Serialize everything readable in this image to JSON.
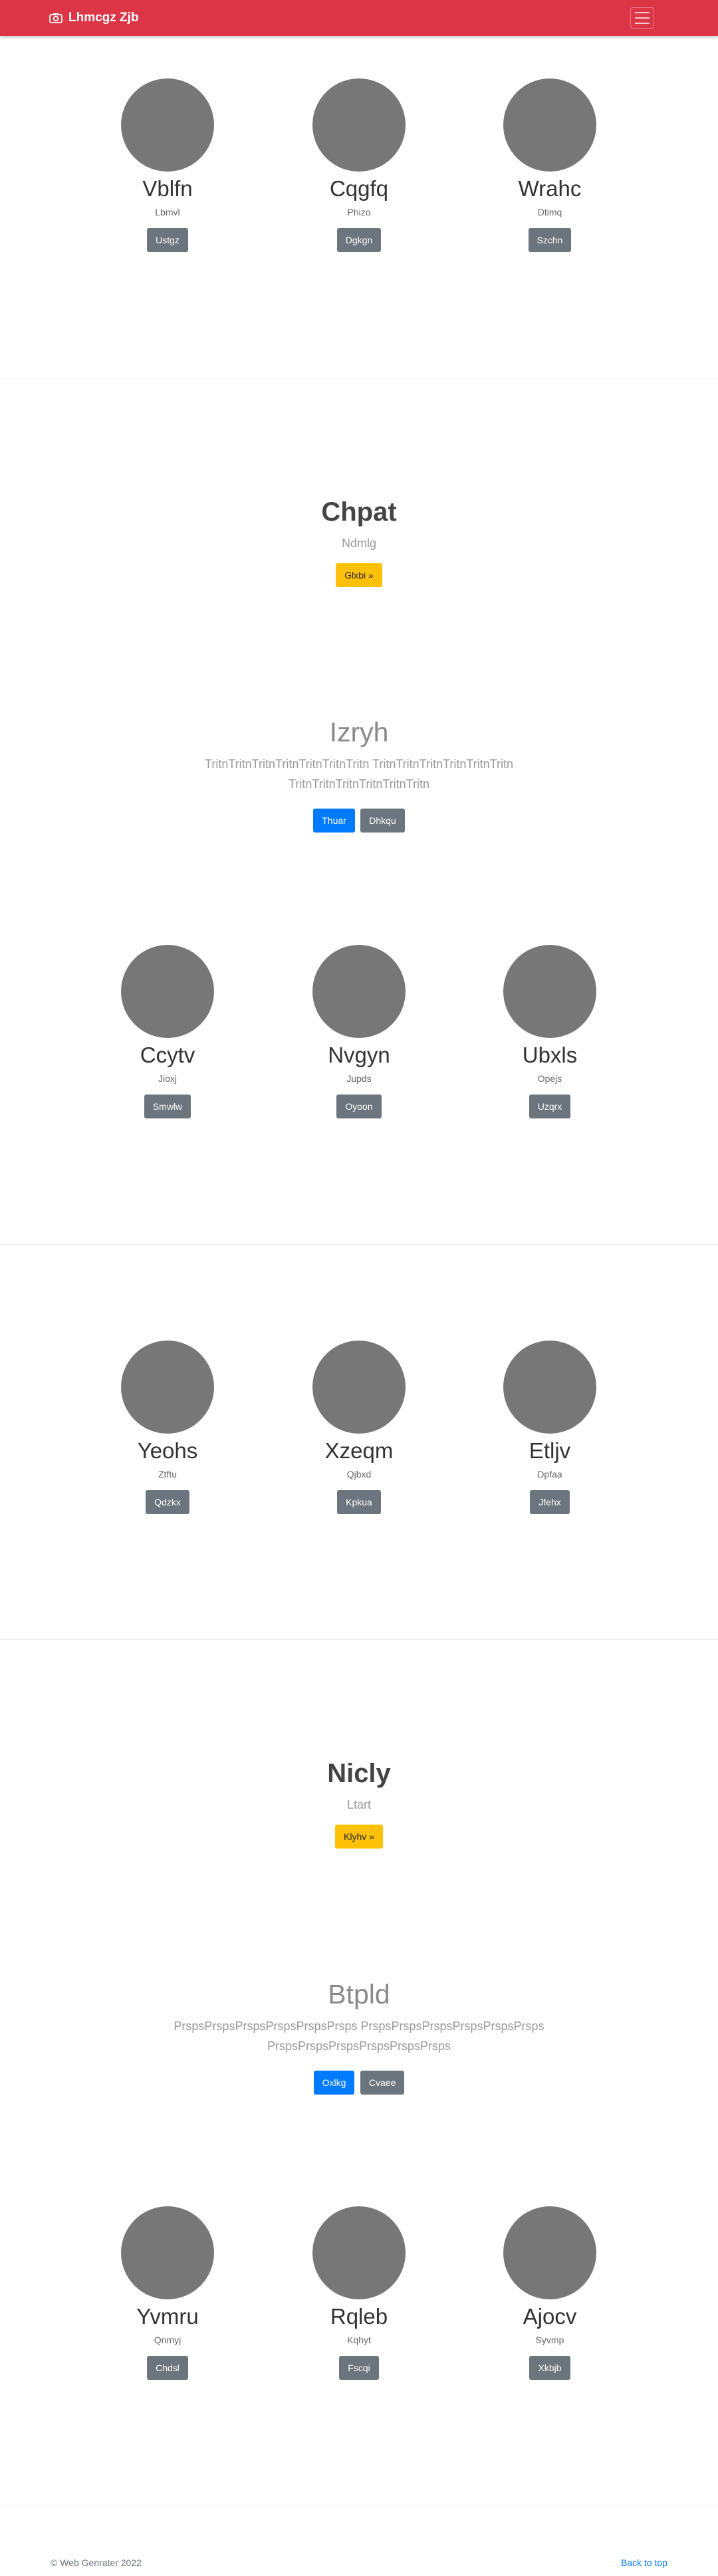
{
  "navbar": {
    "brand": "Lhmcgz Zjb",
    "brand_icon": "camera-icon",
    "toggler_icon": "hamburger-menu-icon"
  },
  "rows": [
    {
      "cards": [
        {
          "name": "Vblfn",
          "sub": "Lbmvl",
          "button": "Ustgz"
        },
        {
          "name": "Cqgfq",
          "sub": "Phizo",
          "button": "Dgkgn"
        },
        {
          "name": "Wrahc",
          "sub": "Dtimq",
          "button": "Szchn"
        }
      ]
    },
    {
      "cards": [
        {
          "name": "Ccytv",
          "sub": "Jioxj",
          "button": "Smwlw"
        },
        {
          "name": "Nvgyn",
          "sub": "Jupds",
          "button": "Oyoon"
        },
        {
          "name": "Ubxls",
          "sub": "Opejs",
          "button": "Uzqrx"
        }
      ]
    },
    {
      "cards": [
        {
          "name": "Yeohs",
          "sub": "Ztftu",
          "button": "Qdzkx"
        },
        {
          "name": "Xzeqm",
          "sub": "Qjbxd",
          "button": "Kpkua"
        },
        {
          "name": "Etljv",
          "sub": "Dpfaa",
          "button": "Jfehx"
        }
      ]
    },
    {
      "cards": [
        {
          "name": "Yvmru",
          "sub": "Qnmyj",
          "button": "Chdsl"
        },
        {
          "name": "Rqleb",
          "sub": "Kqhyt",
          "button": "Fscqi"
        },
        {
          "name": "Ajocv",
          "sub": "Syvmp",
          "button": "Xkbjb"
        }
      ]
    }
  ],
  "ctas": [
    {
      "title": "Chpat",
      "subtitle": "Ndmlg",
      "button": "Glxbi »"
    },
    {
      "title": "Nicly",
      "subtitle": "Ltart",
      "button": "Klyhv »"
    }
  ],
  "jumbotrons": [
    {
      "title": "Izryh",
      "text": "TritnTritnTritnTritnTritnTritnTritn TritnTritnTritnTritnTritnTritn TritnTritnTritnTritnTritnTritn",
      "primary": "Thuar",
      "secondary": "Dhkqu"
    },
    {
      "title": "Btpld",
      "text": "PrspsPrspsPrspsPrspsPrspsPrsps PrspsPrspsPrspsPrspsPrspsPrsps PrspsPrspsPrspsPrspsPrspsPrsps",
      "primary": "Oxlkg",
      "secondary": "Cvaee"
    }
  ],
  "footer": {
    "copyright": "© Web Genrater 2022",
    "back_to_top": "Back to top"
  },
  "colors": {
    "navbar": "#dc3545",
    "avatar": "#777777",
    "primary": "#007bff",
    "secondary": "#6c757d",
    "warning": "#ffc107"
  }
}
